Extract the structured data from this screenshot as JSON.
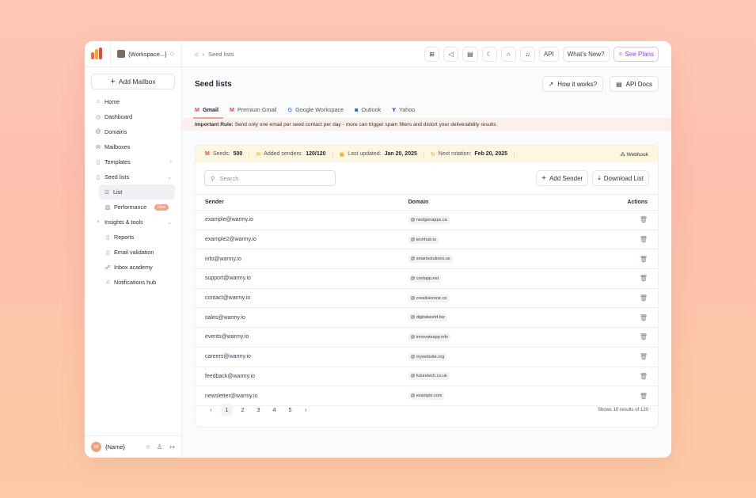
{
  "workspace": {
    "name": "{Workspace...}"
  },
  "sidebar": {
    "add_mailbox": "Add Mailbox",
    "items": [
      {
        "label": "Home",
        "icon": "home-icon"
      },
      {
        "label": "Dashboard",
        "icon": "dashboard-icon"
      },
      {
        "label": "Domains",
        "icon": "at-icon"
      },
      {
        "label": "Mailboxes",
        "icon": "mail-icon"
      },
      {
        "label": "Templates",
        "icon": "file-icon"
      },
      {
        "label": "Seed lists",
        "icon": "file-icon"
      },
      {
        "label": "List",
        "icon": "list-icon"
      },
      {
        "label": "Performance",
        "icon": "chart-icon",
        "badge": "New"
      },
      {
        "label": "Insights & tools",
        "icon": "bulb-icon"
      },
      {
        "label": "Reports",
        "icon": "file-icon"
      },
      {
        "label": "Email validation",
        "icon": "file-icon"
      },
      {
        "label": "Inbox academy",
        "icon": "academy-icon"
      },
      {
        "label": "Notifications hub",
        "icon": "bell-icon"
      }
    ],
    "user": {
      "initial": "W",
      "name": "{Name}"
    }
  },
  "topbar": {
    "breadcrumb": "Seed lists",
    "api": "API",
    "whats_new": "What's New?",
    "see_plans": "See Plans"
  },
  "page": {
    "title": "Seed lists",
    "how_it_works": "How it works?",
    "api_docs": "API Docs"
  },
  "tabs": [
    {
      "label": "Gmail",
      "icon": "gmail-icon"
    },
    {
      "label": "Premium Gmail",
      "icon": "gmail-icon"
    },
    {
      "label": "Google Workspace",
      "icon": "google-icon"
    },
    {
      "label": "Outlook",
      "icon": "outlook-icon"
    },
    {
      "label": "Yahoo",
      "icon": "yahoo-icon"
    }
  ],
  "rule": {
    "prefix": "Important Rule:",
    "text": " Send only one email per seed contact per day - more can trigger spam filters and distort your deliverability results"
  },
  "stats": {
    "seeds_label": "Seeds:",
    "seeds_value": "500",
    "added_label": "Added senders:",
    "added_value": "120/120",
    "updated_label": "Last updated:",
    "updated_value": "Jan 20, 2025",
    "rotation_label": "Next rotation:",
    "rotation_value": "Feb 20, 2025",
    "webhook": "Webhook"
  },
  "toolbar": {
    "search_placeholder": "Search",
    "add_sender": "Add Sender",
    "download_list": "Download List"
  },
  "table": {
    "columns": [
      "Sender",
      "Domain",
      "Actions"
    ],
    "rows": [
      {
        "sender": "example@warmy.io",
        "domain": "nextgenapps.ca"
      },
      {
        "sender": "example2@warmy.io",
        "domain": "techhub.io"
      },
      {
        "sender": "info@warmy.io",
        "domain": "smartsolutions.us"
      },
      {
        "sender": "support@warmy.io",
        "domain": "coolapp.net"
      },
      {
        "sender": "contact@warmy.io",
        "domain": "creativezone.co"
      },
      {
        "sender": "sales@warmy.io",
        "domain": "digitalworld.biz"
      },
      {
        "sender": "events@warmy.io",
        "domain": "innovateapp.info"
      },
      {
        "sender": "careers@warmy.io",
        "domain": "mywebsite.org"
      },
      {
        "sender": "feedback@warmy.io",
        "domain": "futuretech.co.uk"
      },
      {
        "sender": "newsletter@warmy.io",
        "domain": "example.com"
      }
    ]
  },
  "pagination": {
    "pages": [
      "1",
      "2",
      "3",
      "4",
      "5"
    ],
    "current": "1",
    "summary": "Shows 10 results of 120"
  },
  "colors": {
    "accent": "#f0a590",
    "plans": "#9b3cf0",
    "stats_bg": "#fdf6e0",
    "rule_bg": "#fdf0ec"
  }
}
